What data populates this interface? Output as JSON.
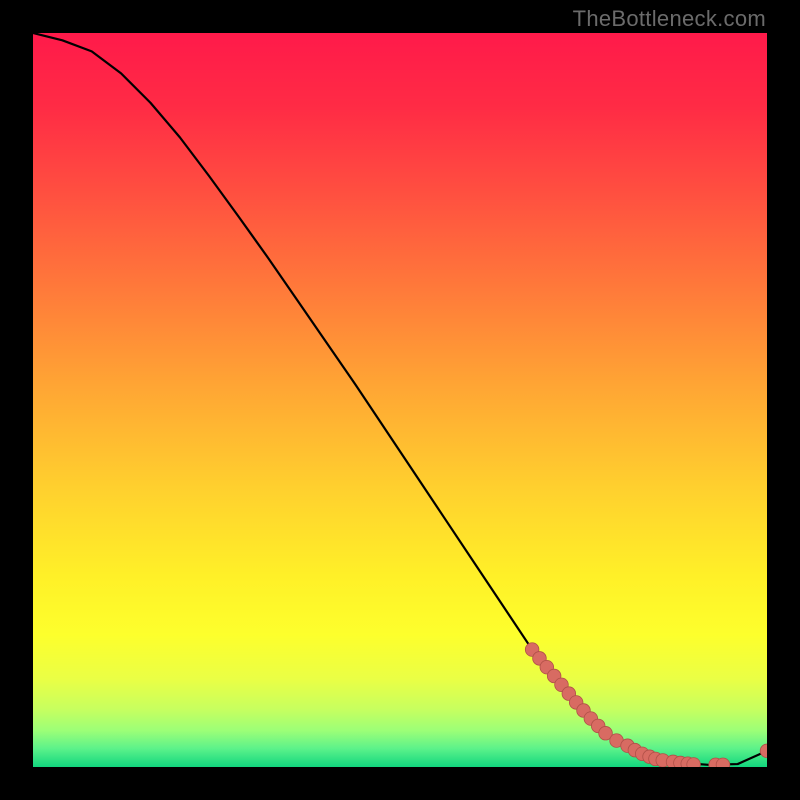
{
  "watermark": "TheBottleneck.com",
  "colors": {
    "line": "#000000",
    "marker_fill": "#d86b62",
    "marker_stroke": "#b05048"
  },
  "chart_data": {
    "type": "line",
    "title": "",
    "xlabel": "",
    "ylabel": "",
    "xlim": [
      0,
      100
    ],
    "ylim": [
      0,
      100
    ],
    "grid": false,
    "background": "vertical gradient red→orange→yellow→green with green band at bottom",
    "series": [
      {
        "name": "curve",
        "kind": "line",
        "x": [
          0,
          4,
          8,
          12,
          16,
          20,
          24,
          28,
          32,
          36,
          40,
          44,
          48,
          52,
          56,
          60,
          64,
          68,
          72,
          76,
          80,
          84,
          88,
          92,
          96,
          100
        ],
        "y": [
          100,
          99,
          97.5,
          94.5,
          90.5,
          85.8,
          80.5,
          75,
          69.4,
          63.6,
          57.8,
          52,
          46,
          40,
          34,
          28,
          22,
          16,
          11,
          6.5,
          3.2,
          1.4,
          0.6,
          0.3,
          0.4,
          2.2
        ]
      },
      {
        "name": "markers",
        "kind": "scatter",
        "x": [
          68,
          69,
          70,
          71,
          72,
          73,
          74,
          75,
          76,
          77,
          78,
          79.5,
          81,
          82,
          83,
          84,
          84.8,
          85.8,
          87.2,
          88.2,
          89.2,
          90,
          93,
          94,
          100
        ],
        "y": [
          16,
          14.8,
          13.6,
          12.4,
          11.2,
          10,
          8.8,
          7.7,
          6.6,
          5.6,
          4.6,
          3.6,
          2.9,
          2.3,
          1.8,
          1.4,
          1.1,
          0.9,
          0.7,
          0.55,
          0.45,
          0.35,
          0.3,
          0.3,
          2.2
        ]
      }
    ]
  }
}
